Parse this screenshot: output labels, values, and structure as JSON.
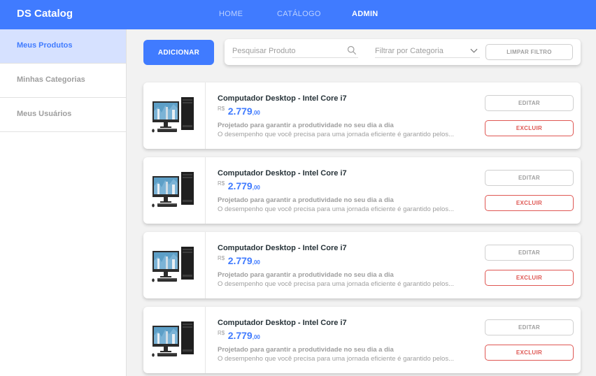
{
  "navbar": {
    "brand": "DS Catalog",
    "links": [
      "HOME",
      "CATÁLOGO",
      "ADMIN"
    ],
    "active": "ADMIN",
    "color": "#407bff"
  },
  "sidebar": {
    "items": [
      {
        "label": "Meus Produtos",
        "active": true
      },
      {
        "label": "Minhas Categorias",
        "active": false
      },
      {
        "label": "Meus Usuários",
        "active": false
      }
    ]
  },
  "toolbar": {
    "add_label": "ADICIONAR",
    "search_placeholder": "Pesquisar Produto",
    "search_icon": "search-icon",
    "category_placeholder": "Filtrar por Categoria",
    "category_icon": "chevron-down-icon",
    "clear_label": "LIMPAR FILTRO"
  },
  "products": [
    {
      "name": "Computador Desktop - Intel Core i7",
      "currency": "R$",
      "price_int": "2.779",
      "price_cents": ",00",
      "desc_title": "Projetado para garantir a produtividade no seu dia a dia",
      "desc_text": "O desempenho que você precisa para uma jornada eficiente é garantido pelos...",
      "edit_label": "EDITAR",
      "delete_label": "EXCLUIR"
    },
    {
      "name": "Computador Desktop - Intel Core i7",
      "currency": "R$",
      "price_int": "2.779",
      "price_cents": ",00",
      "desc_title": "Projetado para garantir a produtividade no seu dia a dia",
      "desc_text": "O desempenho que você precisa para uma jornada eficiente é garantido pelos...",
      "edit_label": "EDITAR",
      "delete_label": "EXCLUIR"
    },
    {
      "name": "Computador Desktop - Intel Core i7",
      "currency": "R$",
      "price_int": "2.779",
      "price_cents": ",00",
      "desc_title": "Projetado para garantir a produtividade no seu dia a dia",
      "desc_text": "O desempenho que você precisa para uma jornada eficiente é garantido pelos...",
      "edit_label": "EDITAR",
      "delete_label": "EXCLUIR"
    },
    {
      "name": "Computador Desktop - Intel Core i7",
      "currency": "R$",
      "price_int": "2.779",
      "price_cents": ",00",
      "desc_title": "Projetado para garantir a produtividade no seu dia a dia",
      "desc_text": "O desempenho que você precisa para uma jornada eficiente é garantido pelos...",
      "edit_label": "EDITAR",
      "delete_label": "EXCLUIR"
    }
  ]
}
